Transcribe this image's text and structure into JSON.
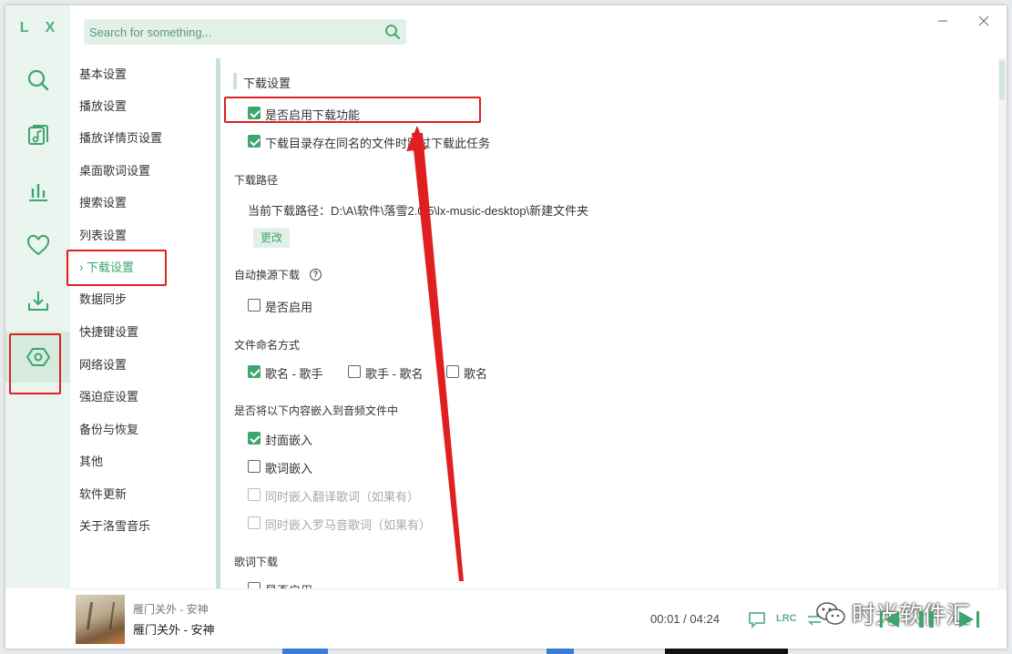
{
  "app": {
    "logo": "L X"
  },
  "search": {
    "placeholder": "Search for something..."
  },
  "nav": {
    "items": [
      {
        "label": "基本设置"
      },
      {
        "label": "播放设置"
      },
      {
        "label": "播放详情页设置"
      },
      {
        "label": "桌面歌词设置"
      },
      {
        "label": "搜索设置"
      },
      {
        "label": "列表设置"
      },
      {
        "label": "下载设置",
        "active": true
      },
      {
        "label": "数据同步"
      },
      {
        "label": "快捷键设置"
      },
      {
        "label": "网络设置"
      },
      {
        "label": "强迫症设置"
      },
      {
        "label": "备份与恢复"
      },
      {
        "label": "其他"
      },
      {
        "label": "软件更新"
      },
      {
        "label": "关于洛雪音乐"
      }
    ],
    "active_marker": "›"
  },
  "download": {
    "section_title": "下载设置",
    "enable_label": "是否启用下载功能",
    "enable_checked": true,
    "skip_label": "下载目录存在同名的文件时跳过下载此任务",
    "skip_checked": true,
    "path_heading": "下载路径",
    "path_text": "当前下载路径：D:\\A\\软件\\落雪2.0.5\\lx-music-desktop\\新建文件夹",
    "change_button": "更改",
    "auto_switch_heading": "自动换源下载",
    "auto_switch_label": "是否启用",
    "auto_switch_checked": false,
    "naming_heading": "文件命名方式",
    "naming_options": [
      {
        "label": "歌名 - 歌手",
        "checked": true
      },
      {
        "label": "歌手 - 歌名",
        "checked": false
      },
      {
        "label": "歌名",
        "checked": false
      }
    ],
    "embed_heading": "是否将以下内容嵌入到音频文件中",
    "embed_options": [
      {
        "label": "封面嵌入",
        "checked": true,
        "disabled": false
      },
      {
        "label": "歌词嵌入",
        "checked": false,
        "disabled": false
      },
      {
        "label": "同时嵌入翻译歌词（如果有）",
        "checked": false,
        "disabled": true
      },
      {
        "label": "同时嵌入罗马音歌词（如果有）",
        "checked": false,
        "disabled": true
      }
    ],
    "lyric_heading": "歌词下载",
    "lyric_label": "是否启用"
  },
  "player": {
    "subtitle": "雁门关外 - 安神",
    "title": "雁门关外 - 安神",
    "current_time": "00:01",
    "separator": "/",
    "total_time": "04:24",
    "lrc_label": "LRC"
  },
  "watermark": {
    "text": "时光软件汇"
  },
  "colors": {
    "accent": "#3da56d",
    "rail_bg": "#ebf5ef",
    "annotation": "#e02020"
  }
}
